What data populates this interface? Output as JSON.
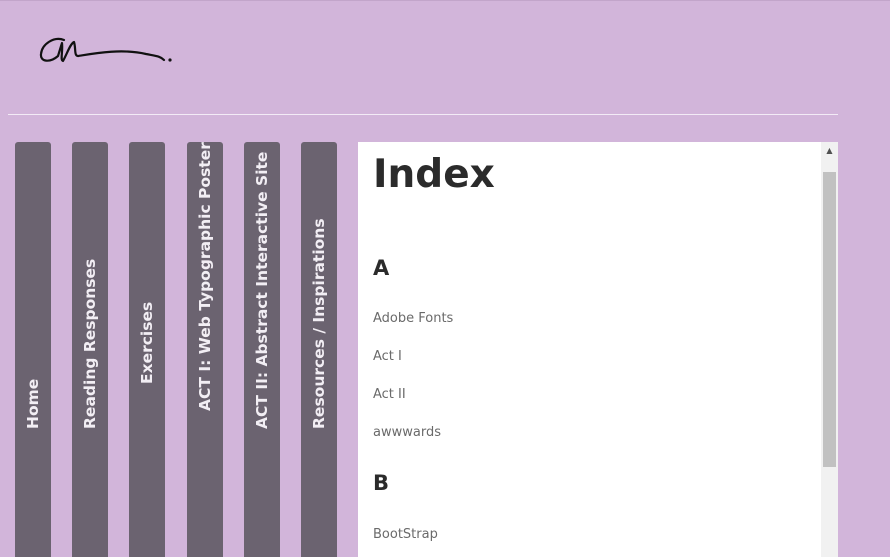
{
  "colors": {
    "background": "#d2b5da",
    "nav_tab": "#6b6370",
    "nav_text": "#f2eef4",
    "content_bg": "#ffffff",
    "heading_text": "#2b2b2b",
    "entry_text": "#6a6a6a"
  },
  "logo": {
    "kind": "handwritten-signature-logo"
  },
  "nav": {
    "items": [
      {
        "label": "Home"
      },
      {
        "label": "Reading Responses"
      },
      {
        "label": "Exercises"
      },
      {
        "label": "ACT I: Web Typographic Poster"
      },
      {
        "label": "ACT II: Abstract Interactive Site"
      },
      {
        "label": "Resources / Inspirations"
      }
    ]
  },
  "index": {
    "title": "Index",
    "sections": [
      {
        "letter": "A",
        "entries": [
          "Adobe Fonts",
          "Act I",
          "Act II",
          "awwwards"
        ]
      },
      {
        "letter": "B",
        "entries": [
          "BootStrap"
        ]
      }
    ]
  },
  "scrollbar": {
    "up_icon": "triangle-up-icon"
  }
}
